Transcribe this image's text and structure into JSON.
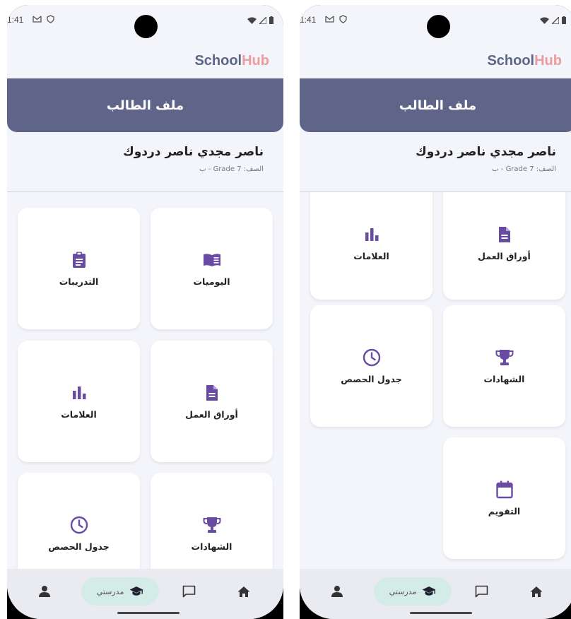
{
  "status": {
    "time": "1:41"
  },
  "brand": {
    "part1": "School",
    "part2": "Hub"
  },
  "header": {
    "title": "ملف الطالب"
  },
  "student": {
    "name": "ناصر مجدي ناصر دردوك",
    "grade": "الصف: Grade 7 - ب"
  },
  "tiles": {
    "diaries": "اليوميات",
    "exercises": "التدريبات",
    "worksheets": "أوراق العمل",
    "marks": "العلامات",
    "certificates": "الشهادات",
    "schedule": "جدول الحصص",
    "calendar": "التقويم"
  },
  "nav": {
    "school": "مدرستي"
  },
  "colors": {
    "accent": "#6a4ba3",
    "header": "#5f6589",
    "brand_primary": "#5b6587",
    "brand_secondary": "#ec9b9f",
    "pill": "#d4ece7"
  }
}
